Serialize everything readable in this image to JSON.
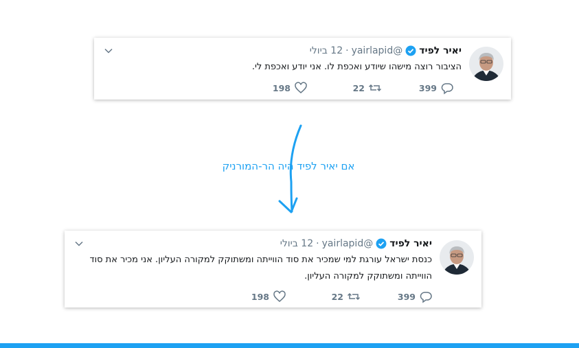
{
  "tweets": [
    {
      "name": "יאיר לפיד",
      "handle": "@yairlapid",
      "separator": "·",
      "date": "12 ביולי",
      "text": "הציבור רוצה מישהו שיודע ואכפת לו. אני יודע ואכפת לי.",
      "replies": "399",
      "retweets": "22",
      "likes": "198"
    },
    {
      "name": "יאיר לפיד",
      "handle": "@yairlapid",
      "separator": "·",
      "date": "12 ביולי",
      "text": "כנסת ישראל עורגת למי שמכיר את סוד הווייתה ומשתוקק למקורה העליון. אני מכיר את סוד הווייתה ומשתוקק למקורה העליון.",
      "replies": "399",
      "retweets": "22",
      "likes": "198"
    }
  ],
  "caption": "אם יאיר לפיד היה הר-המורניק",
  "colors": {
    "accent": "#1da1f2",
    "secondary_text": "#657786"
  }
}
